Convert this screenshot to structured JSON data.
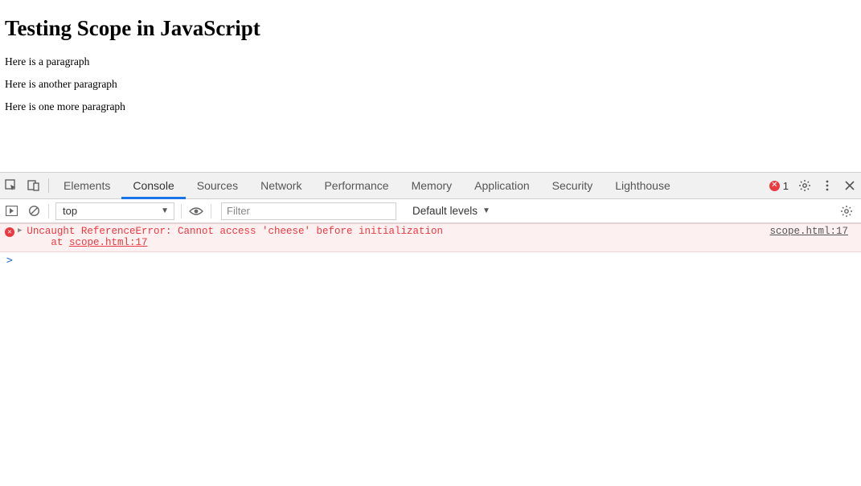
{
  "page": {
    "heading": "Testing Scope in JavaScript",
    "paragraphs": [
      "Here is a paragraph",
      "Here is another paragraph",
      "Here is one more paragraph"
    ]
  },
  "devtools": {
    "tabs": [
      "Elements",
      "Console",
      "Sources",
      "Network",
      "Performance",
      "Memory",
      "Application",
      "Security",
      "Lighthouse"
    ],
    "active_tab": "Console",
    "error_count": "1",
    "toolbar": {
      "context": "top",
      "filter_placeholder": "Filter",
      "levels": "Default levels"
    },
    "console": {
      "error_message": "Uncaught ReferenceError: Cannot access 'cheese' before initialization",
      "at_prefix": "at ",
      "at_location": "scope.html:17",
      "source_link": "scope.html:17",
      "prompt": ">"
    }
  }
}
